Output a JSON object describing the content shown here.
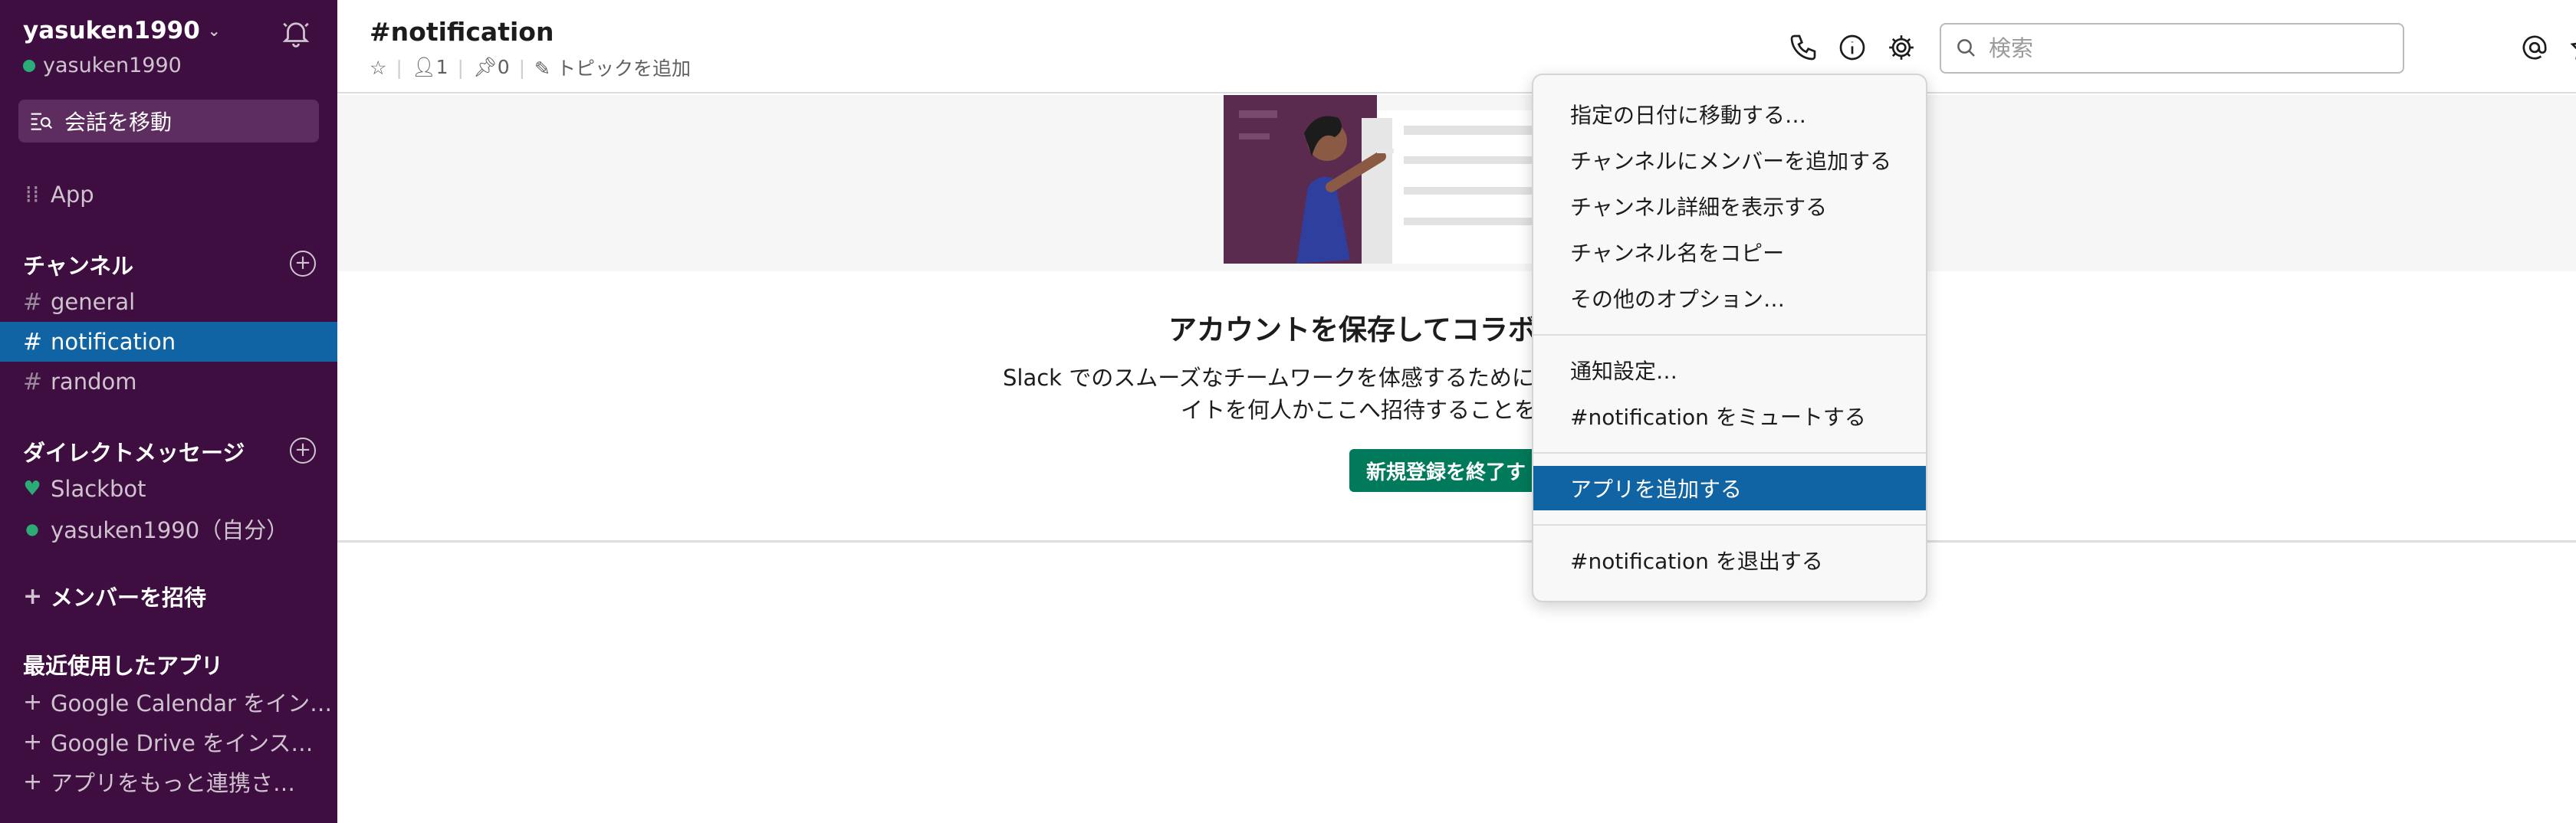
{
  "workspace": {
    "name": "yasuken1990",
    "user": "yasuken1990"
  },
  "switcher": {
    "label": "会話を移動"
  },
  "sidebar": {
    "app_label": "App",
    "channels_title": "チャンネル",
    "channels": [
      "general",
      "notification",
      "random"
    ],
    "active_channel": "notification",
    "dm_title": "ダイレクトメッセージ",
    "dms": [
      "Slackbot",
      "yasuken1990（自分）"
    ],
    "invite_label": "メンバーを招待",
    "recent_apps_title": "最近使用したアプリ",
    "recent_apps": [
      "Google Calendar をイン…",
      "Google Drive をインス…",
      "アプリをもっと連携さ…"
    ]
  },
  "header": {
    "channel_title": "#notification",
    "member_count": "1",
    "pin_count": "0",
    "add_topic": "トピックを追加",
    "search_placeholder": "検索"
  },
  "main": {
    "promo_title": "アカウントを保存してコラボ",
    "promo_text_line1": "Slack でのスムーズなチームワークを体感するために",
    "promo_text_line2": "イトを何人かここへ招待することを",
    "cta_label": "新規登録を終了す"
  },
  "menu": {
    "items": [
      "指定の日付に移動する…",
      "チャンネルにメンバーを追加する",
      "チャンネル詳細を表示する",
      "チャンネル名をコピー",
      "その他のオプション…",
      "通知設定…",
      "#notification をミュートする",
      "アプリを追加する",
      "#notification を退出する"
    ],
    "highlighted": "アプリを追加する"
  },
  "colors": {
    "sidebar_bg": "#3f0e40",
    "active_item": "#1164a3",
    "presence": "#2bac76",
    "cta_green": "#007a5a"
  }
}
